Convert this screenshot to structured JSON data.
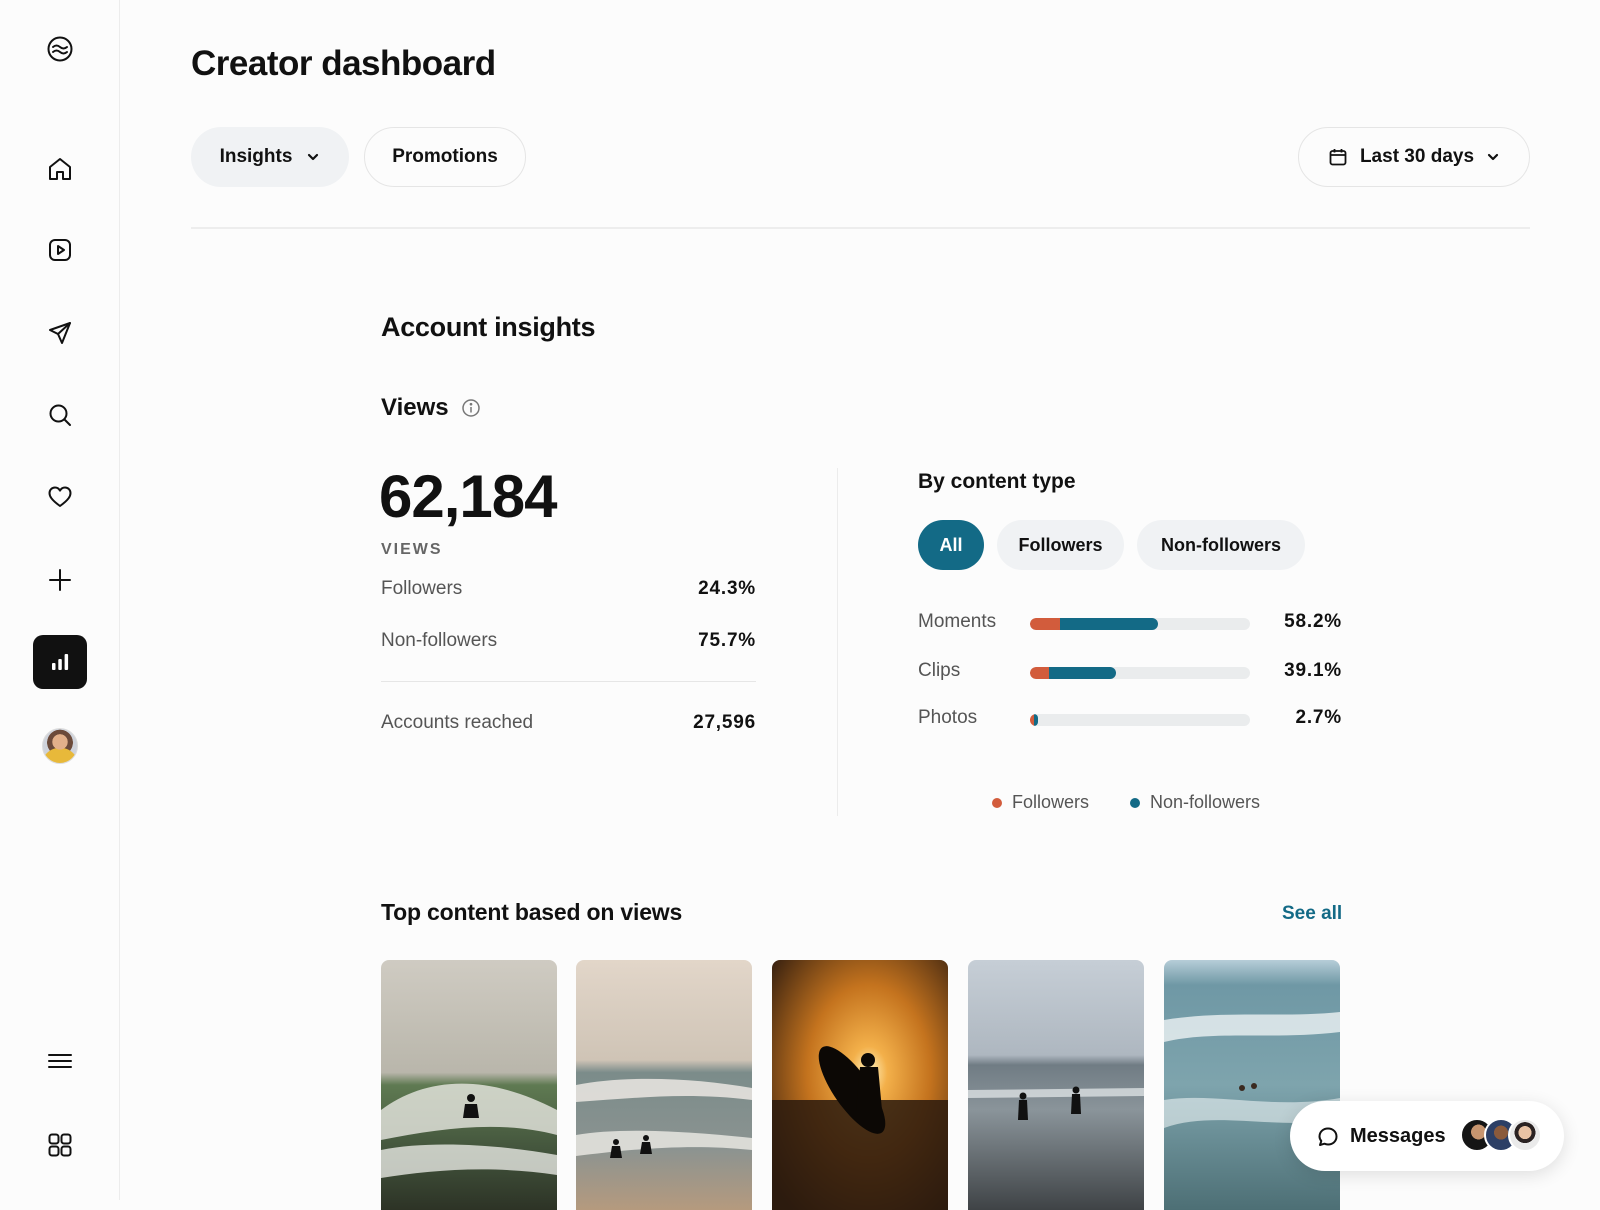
{
  "page": {
    "title": "Creator dashboard"
  },
  "header": {
    "insights_label": "Insights",
    "promotions_label": "Promotions",
    "date_range_label": "Last 30 days"
  },
  "sidebar": {
    "items": [
      {
        "name": "home",
        "icon": "home-icon"
      },
      {
        "name": "reels",
        "icon": "play-square-icon"
      },
      {
        "name": "messages",
        "icon": "send-icon"
      },
      {
        "name": "search",
        "icon": "search-icon"
      },
      {
        "name": "notifications",
        "icon": "heart-icon"
      },
      {
        "name": "create",
        "icon": "plus-icon"
      },
      {
        "name": "dashboard",
        "icon": "bar-chart-icon",
        "active": true
      },
      {
        "name": "profile",
        "icon": "avatar"
      }
    ],
    "bottom_items": [
      {
        "name": "menu",
        "icon": "hamburger-menu-icon"
      },
      {
        "name": "apps",
        "icon": "grid-icon"
      }
    ]
  },
  "insights": {
    "section_title": "Account insights",
    "views_title": "Views",
    "views_total": "62,184",
    "views_caption": "VIEWS",
    "stats": [
      {
        "label": "Followers",
        "value": "24.3%"
      },
      {
        "label": "Non-followers",
        "value": "75.7%"
      },
      {
        "label": "Accounts reached",
        "value": "27,596"
      }
    ]
  },
  "content_type": {
    "title": "By content type",
    "filters": [
      "All",
      "Followers",
      "Non-followers"
    ],
    "selected_filter": "All",
    "rows": [
      {
        "label": "Moments",
        "percent": "58.2%",
        "followers_share": 13.5,
        "nonfollowers_share": 44.7
      },
      {
        "label": "Clips",
        "percent": "39.1%",
        "followers_share": 8.5,
        "nonfollowers_share": 30.6
      },
      {
        "label": "Photos",
        "percent": "2.7%",
        "followers_share": 1.6,
        "nonfollowers_share": 1.6
      }
    ],
    "legend": [
      {
        "label": "Followers",
        "color": "#d25c3c"
      },
      {
        "label": "Non-followers",
        "color": "#136a86"
      }
    ]
  },
  "top_content": {
    "title": "Top content based on views",
    "see_all_label": "See all"
  },
  "messages_bar": {
    "label": "Messages"
  },
  "colors": {
    "accent": "#136a86",
    "followers": "#d25c3c",
    "nonfollowers": "#136a86"
  }
}
